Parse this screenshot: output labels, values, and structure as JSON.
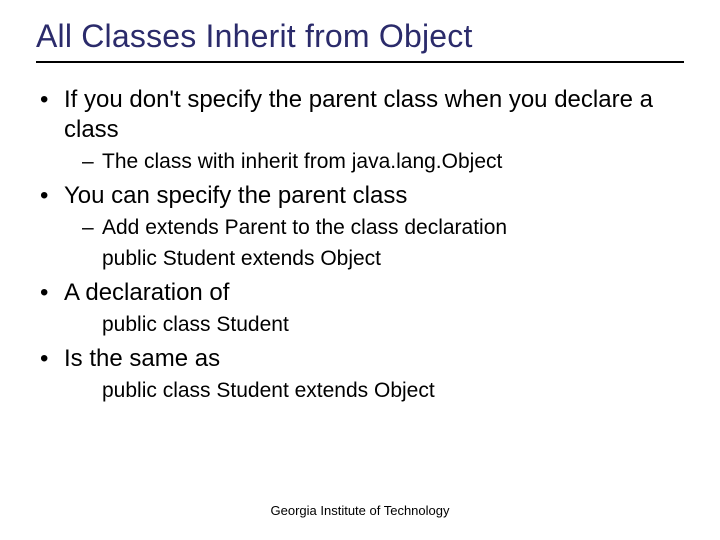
{
  "title": "All Classes Inherit from Object",
  "bullets": {
    "b1": "If you don't specify the parent class when you declare a class",
    "b1_sub1": "The class with inherit from java.lang.Object",
    "b2": "You can specify the parent class",
    "b2_sub1": "Add extends Parent to the class declaration",
    "b2_sub2": "public Student extends Object",
    "b3": "A declaration of",
    "b3_sub1": "public class Student",
    "b4": "Is the same as",
    "b4_sub1": "public class Student extends Object"
  },
  "footer": "Georgia Institute of Technology"
}
